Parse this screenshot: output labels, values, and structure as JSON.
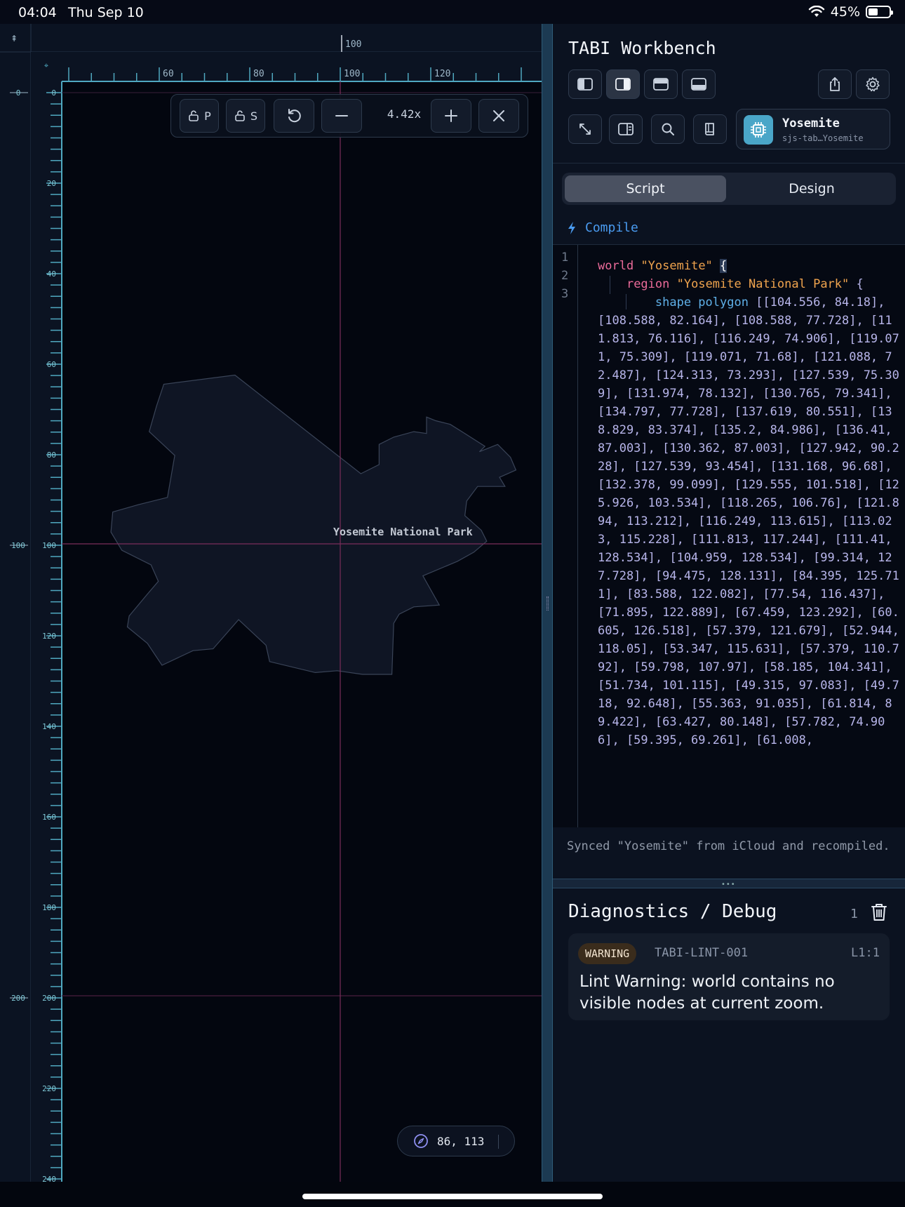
{
  "status": {
    "time": "04:04",
    "date": "Thu Sep 10",
    "battery": "45%",
    "battery_level": 0.45
  },
  "canvas": {
    "ruler_top_major_label": "100",
    "ruler_x_labels": [
      "60",
      "80",
      "100",
      "120"
    ],
    "ruler_y_labels": [
      "0",
      "20",
      "40",
      "60",
      "80",
      "100",
      "120",
      "140",
      "160",
      "180",
      "200",
      "220",
      "240"
    ],
    "ruler_outer_y_labels": [
      "0",
      "100",
      "200"
    ],
    "region_label": "Yosemite National Park",
    "region_polygon": [
      [
        104.556,
        84.18
      ],
      [
        108.588,
        82.164
      ],
      [
        108.588,
        77.728
      ],
      [
        111.813,
        76.116
      ],
      [
        116.249,
        74.906
      ],
      [
        119.071,
        75.309
      ],
      [
        119.071,
        71.68
      ],
      [
        121.088,
        72.487
      ],
      [
        124.313,
        73.293
      ],
      [
        127.539,
        75.309
      ],
      [
        131.974,
        78.132
      ],
      [
        130.765,
        79.341
      ],
      [
        134.797,
        77.728
      ],
      [
        137.619,
        80.551
      ],
      [
        138.829,
        83.374
      ],
      [
        135.2,
        84.986
      ],
      [
        136.41,
        87.003
      ],
      [
        130.362,
        87.003
      ],
      [
        127.942,
        90.228
      ],
      [
        127.539,
        93.454
      ],
      [
        131.168,
        96.68
      ],
      [
        132.378,
        99.099
      ],
      [
        129.555,
        101.518
      ],
      [
        125.926,
        103.534
      ],
      [
        118.265,
        106.76
      ],
      [
        121.894,
        113.212
      ],
      [
        116.249,
        113.615
      ],
      [
        113.023,
        115.228
      ],
      [
        111.813,
        117.244
      ],
      [
        111.41,
        128.534
      ],
      [
        104.959,
        128.534
      ],
      [
        99.314,
        127.728
      ],
      [
        94.475,
        128.131
      ],
      [
        84.395,
        125.711
      ],
      [
        83.588,
        122.082
      ],
      [
        77.54,
        116.437
      ],
      [
        71.895,
        122.889
      ],
      [
        67.459,
        123.292
      ],
      [
        60.605,
        126.518
      ],
      [
        57.379,
        121.679
      ],
      [
        52.944,
        118.05
      ],
      [
        53.347,
        115.631
      ],
      [
        57.379,
        110.792
      ],
      [
        59.798,
        107.97
      ],
      [
        58.185,
        104.341
      ],
      [
        51.734,
        101.115
      ],
      [
        49.315,
        97.083
      ],
      [
        49.718,
        92.648
      ],
      [
        55.363,
        91.035
      ],
      [
        61.814,
        89.422
      ],
      [
        63.427,
        80.148
      ],
      [
        57.782,
        74.906
      ],
      [
        59.395,
        69.261
      ],
      [
        61.008,
        64.422
      ],
      [
        76.733,
        62.406
      ]
    ],
    "toolbar": {
      "lock_p_label": "P",
      "lock_s_label": "S",
      "zoom": "4.42x"
    },
    "cursor_coords": "86, 113"
  },
  "panel": {
    "title": "TABI Workbench",
    "world": {
      "name": "Yosemite",
      "id": "sjs-tab…Yosemite"
    },
    "tabs": {
      "script": "Script",
      "design": "Design"
    },
    "compile_label": "Compile",
    "line_numbers": [
      "1",
      "2",
      "3"
    ],
    "code": {
      "kw_world": "world",
      "world_name": "\"Yosemite\"",
      "kw_region": "region",
      "region_name": "\"Yosemite National Park\"",
      "kw_shape": "shape polygon",
      "polygon_text": "[[104.556, 84.18], [108.588, 82.164], [108.588, 77.728], [111.813, 76.116], [116.249, 74.906], [119.071, 75.309], [119.071, 71.68], [121.088, 72.487], [124.313, 73.293], [127.539, 75.309], [131.974, 78.132], [130.765, 79.341], [134.797, 77.728], [137.619, 80.551], [138.829, 83.374], [135.2, 84.986], [136.41, 87.003], [130.362, 87.003], [127.942, 90.228], [127.539, 93.454], [131.168, 96.68], [132.378, 99.099], [129.555, 101.518], [125.926, 103.534], [118.265, 106.76], [121.894, 113.212], [116.249, 113.615], [113.023, 115.228], [111.813, 117.244], [111.41, 128.534], [104.959, 128.534], [99.314, 127.728], [94.475, 128.131], [84.395, 125.711], [83.588, 122.082], [77.54, 116.437], [71.895, 122.889], [67.459, 123.292], [60.605, 126.518], [57.379, 121.679], [52.944, 118.05], [53.347, 115.631], [57.379, 110.792], [59.798, 107.97], [58.185, 104.341], [51.734, 101.115], [49.315, 97.083], [49.718, 92.648], [55.363, 91.035], [61.814, 89.422], [63.427, 80.148], [57.782, 74.906], [59.395, 69.261], [61.008,"
    },
    "sync_message": "Synced \"Yosemite\" from iCloud and recompiled.",
    "diagnostics": {
      "title": "Diagnostics / Debug",
      "count": "1",
      "items": [
        {
          "severity": "WARNING",
          "code": "TABI-LINT-001",
          "location": "L1:1",
          "message": "Lint Warning: world contains no visible nodes at current zoom."
        }
      ]
    }
  },
  "colors": {
    "accent": "#4a9bf0",
    "ruler_tick": "#4fa8c0",
    "crosshair": "#7a2d5a",
    "region_fill": "#0f1524",
    "region_stroke": "#3a4458"
  }
}
